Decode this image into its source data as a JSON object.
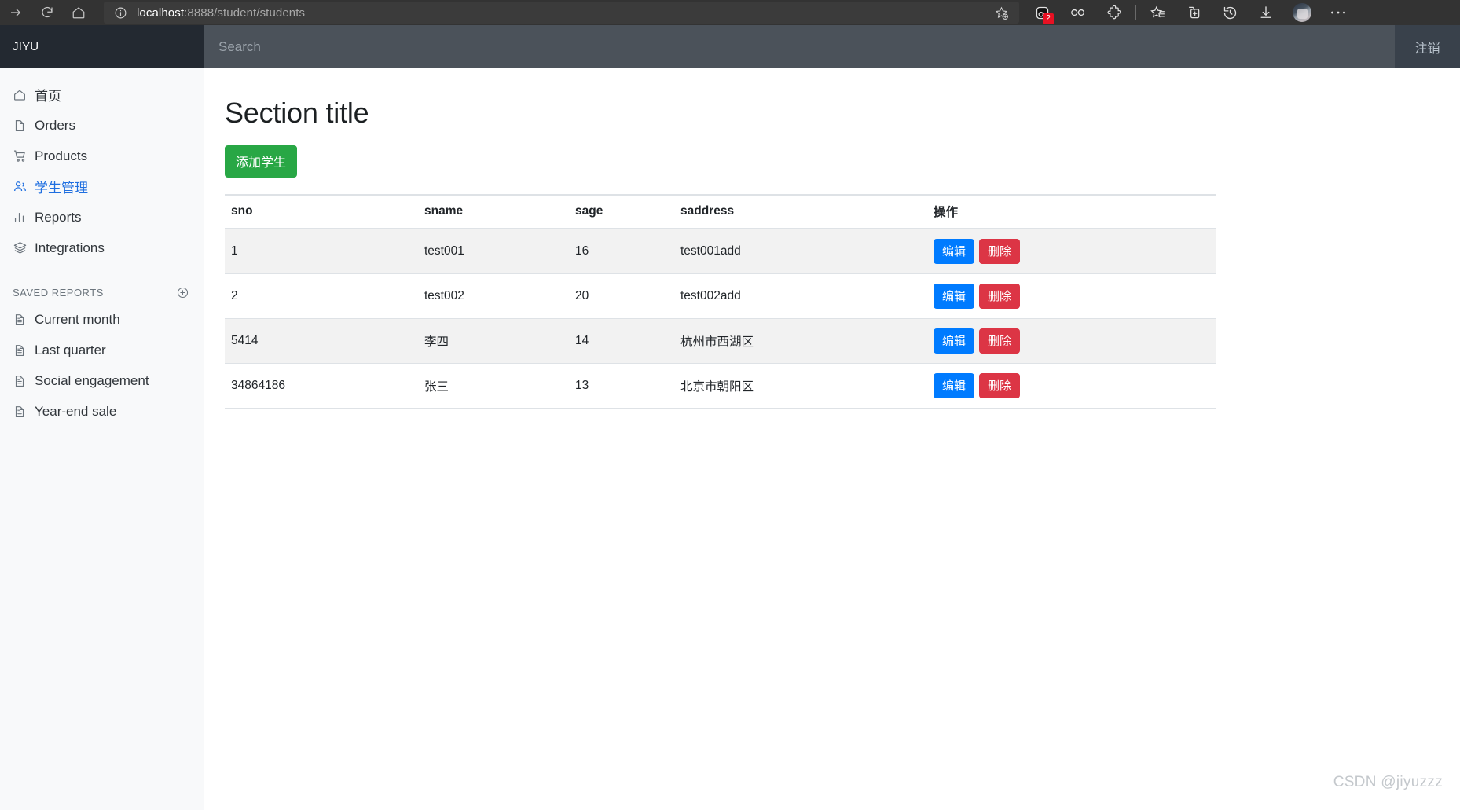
{
  "browser": {
    "forward_tooltip": "Forward",
    "refresh_tooltip": "Refresh",
    "home_tooltip": "Home",
    "site_info_tooltip": "View site information",
    "url_host": "localhost",
    "url_path": ":8888/student/students",
    "url_full": "localhost:8888/student/students",
    "collections_badge": "2",
    "tools": [
      {
        "name": "add-favorite-icon",
        "label": "Add this page to favorites"
      },
      {
        "name": "browser-essentials-icon",
        "label": "Browser essentials"
      },
      {
        "name": "shopping-icon",
        "label": "Shopping"
      },
      {
        "name": "extensions-icon",
        "label": "Extensions"
      },
      {
        "name": "favorites-icon",
        "label": "Favorites"
      },
      {
        "name": "collections-icon",
        "label": "Collections"
      },
      {
        "name": "history-icon",
        "label": "History"
      },
      {
        "name": "downloads-icon",
        "label": "Downloads"
      },
      {
        "name": "profile-avatar",
        "label": "Profile"
      },
      {
        "name": "settings-more-icon",
        "label": "Settings and more"
      }
    ]
  },
  "app": {
    "brand": "JIYU",
    "search_placeholder": "Search",
    "search_value": "",
    "logout_label": "注销"
  },
  "sidebar": {
    "items": [
      {
        "label": "首页",
        "icon": "home-icon",
        "active": false
      },
      {
        "label": "Orders",
        "icon": "file-icon",
        "active": false
      },
      {
        "label": "Products",
        "icon": "cart-icon",
        "active": false
      },
      {
        "label": "学生管理",
        "icon": "users-icon",
        "active": true
      },
      {
        "label": "Reports",
        "icon": "bar-chart-icon",
        "active": false
      },
      {
        "label": "Integrations",
        "icon": "layers-icon",
        "active": false
      }
    ],
    "saved_reports_title": "SAVED REPORTS",
    "saved_reports_add": "+",
    "saved_reports": [
      {
        "label": "Current month",
        "icon": "file-text-icon"
      },
      {
        "label": "Last quarter",
        "icon": "file-text-icon"
      },
      {
        "label": "Social engagement",
        "icon": "file-text-icon"
      },
      {
        "label": "Year-end sale",
        "icon": "file-text-icon"
      }
    ]
  },
  "main": {
    "title": "Section title",
    "add_button": "添加学生",
    "table": {
      "columns": [
        "sno",
        "sname",
        "sage",
        "saddress",
        "操作"
      ],
      "edit_label": "编辑",
      "delete_label": "删除",
      "rows": [
        {
          "sno": "1",
          "sname": "test001",
          "sage": "16",
          "saddress": "test001add"
        },
        {
          "sno": "2",
          "sname": "test002",
          "sage": "20",
          "saddress": "test002add"
        },
        {
          "sno": "5414",
          "sname": "李四",
          "sage": "14",
          "saddress": "杭州市西湖区"
        },
        {
          "sno": "34864186",
          "sname": "张三",
          "sage": "13",
          "saddress": "北京市朝阳区"
        }
      ]
    }
  },
  "watermark": "CSDN @jiyuzzz",
  "colors": {
    "brand_bg": "#232931",
    "topbar_bg": "#4b525a",
    "sidebar_bg": "#f8f9fa",
    "active_nav": "#1f6fe0",
    "add_button": "#28a745",
    "edit_button": "#007bff",
    "delete_button": "#dc3545",
    "badge": "#e81123"
  }
}
